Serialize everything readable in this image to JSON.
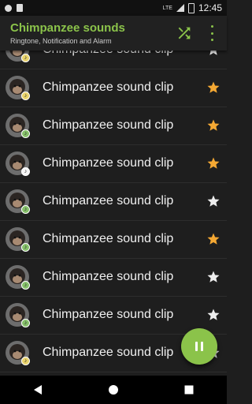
{
  "status_bar": {
    "lte": "LTE",
    "time": "12:45"
  },
  "app_bar": {
    "title": "Chimpanzee sounds",
    "subtitle": "Ringtone, Notification and Alarm",
    "shuffle_icon": "shuffle-icon",
    "more_icon": "more-vert-icon"
  },
  "colors": {
    "accent": "#8bc34a",
    "star_active": "#f4a833",
    "star_inactive": "#eeeeee",
    "badge_yellow": "#e9d36c",
    "badge_green": "#86c06a"
  },
  "sounds": [
    {
      "label": "Chimpanzee sound clip",
      "favorite": false,
      "badge": "yellow"
    },
    {
      "label": "Chimpanzee sound clip",
      "favorite": true,
      "badge": "yellow"
    },
    {
      "label": "Chimpanzee sound clip",
      "favorite": true,
      "badge": "green"
    },
    {
      "label": "Chimpanzee sound clip",
      "favorite": true,
      "badge": "white"
    },
    {
      "label": "Chimpanzee sound clip",
      "favorite": false,
      "badge": "green"
    },
    {
      "label": "Chimpanzee sound clip",
      "favorite": true,
      "badge": "green"
    },
    {
      "label": "Chimpanzee sound clip",
      "favorite": false,
      "badge": "green"
    },
    {
      "label": "Chimpanzee sound clip",
      "favorite": false,
      "badge": "green"
    },
    {
      "label": "Chimpanzee sound clip",
      "favorite": false,
      "badge": "yellow"
    }
  ],
  "fab": {
    "icon": "pause-icon"
  },
  "nav": {
    "back_icon": "back-icon",
    "home_icon": "home-icon",
    "recents_icon": "recents-icon"
  }
}
